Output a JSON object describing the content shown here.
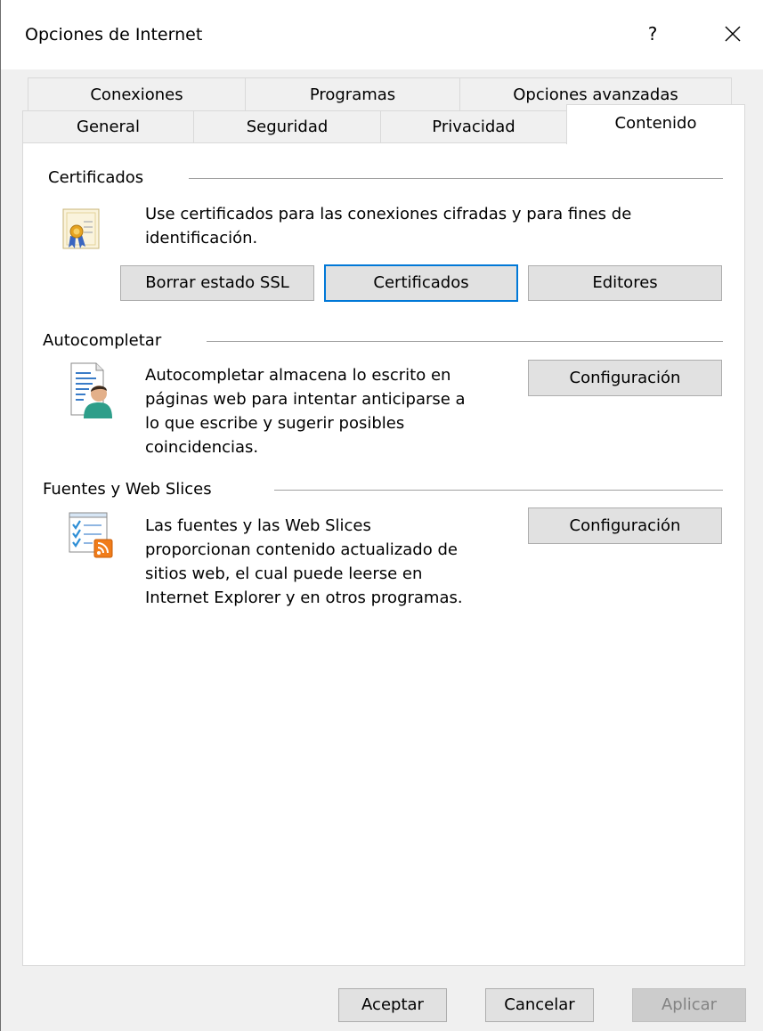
{
  "window": {
    "title": "Opciones de Internet",
    "help_label": "?"
  },
  "tabs": {
    "row1": [
      "Conexiones",
      "Programas",
      "Opciones avanzadas"
    ],
    "row2": [
      "General",
      "Seguridad",
      "Privacidad",
      "Contenido"
    ],
    "active": "Contenido"
  },
  "certificates": {
    "title": "Certificados",
    "description_line1": "Use certificados para las conexiones cifradas y para fines de",
    "description_line2": "identificación.",
    "clear_ssl_label": "Borrar estado SSL",
    "certificates_label": "Certificados",
    "publishers_label": "Editores",
    "icon": "certificate-icon"
  },
  "autocomplete": {
    "title": "Autocompletar",
    "description_lines": [
      "Autocompletar almacena lo escrito en",
      "páginas web para intentar anticiparse a",
      "lo que escribe y sugerir posibles",
      "coincidencias."
    ],
    "settings_label": "Configuración",
    "icon": "autocomplete-user-icon"
  },
  "feeds": {
    "title": "Fuentes y Web Slices",
    "description_lines": [
      "Las fuentes y las Web Slices",
      "proporcionan contenido actualizado de",
      "sitios web, el cual puede leerse en",
      "Internet Explorer y en otros programas."
    ],
    "settings_label": "Configuración",
    "icon": "feeds-rss-icon"
  },
  "footer": {
    "ok_label": "Aceptar",
    "cancel_label": "Cancelar",
    "apply_label": "Aplicar"
  },
  "colors": {
    "focus_border": "#0078d7",
    "rss_orange": "#f07c1a"
  }
}
